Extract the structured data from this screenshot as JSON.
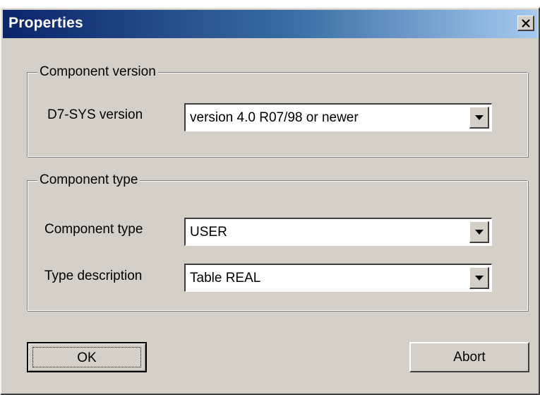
{
  "window": {
    "title": "Properties",
    "close_icon": "close-icon"
  },
  "component_version": {
    "legend": "Component version",
    "d7sys_label": "D7-SYS version",
    "d7sys_value": "version 4.0 R07/98 or newer"
  },
  "component_type": {
    "legend": "Component type",
    "type_label": "Component type",
    "type_value": "USER",
    "description_label": "Type description",
    "description_value": "Table REAL"
  },
  "buttons": {
    "ok_label": "OK",
    "abort_label": "Abort"
  },
  "colors": {
    "title_gradient_start": "#0a246a",
    "title_gradient_end": "#a6caf0",
    "face": "#d4d0c8"
  }
}
